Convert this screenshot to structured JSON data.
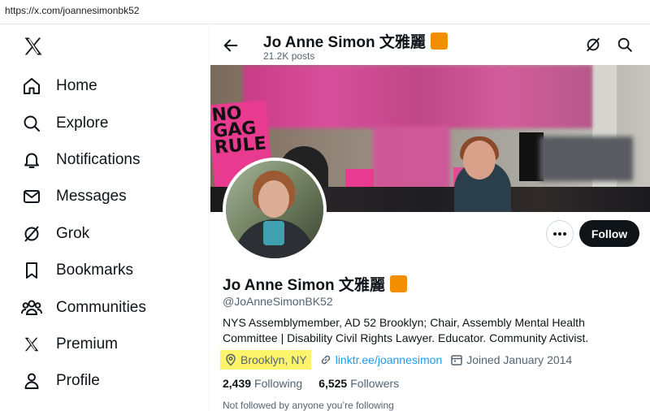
{
  "browser": {
    "url": "https://x.com/joannesimonbk52"
  },
  "sidebar": {
    "items": [
      {
        "label": "Home",
        "icon": "home-icon"
      },
      {
        "label": "Explore",
        "icon": "search-icon"
      },
      {
        "label": "Notifications",
        "icon": "bell-icon"
      },
      {
        "label": "Messages",
        "icon": "envelope-icon"
      },
      {
        "label": "Grok",
        "icon": "grok-icon"
      },
      {
        "label": "Bookmarks",
        "icon": "bookmark-icon"
      },
      {
        "label": "Communities",
        "icon": "people-icon"
      },
      {
        "label": "Premium",
        "icon": "x-logo-icon"
      },
      {
        "label": "Profile",
        "icon": "person-icon"
      }
    ]
  },
  "header": {
    "name": "Jo Anne Simon 文雅麗",
    "posts": "21.2K posts"
  },
  "banner": {
    "sign_text": "NO GAG RULE"
  },
  "profile": {
    "name": "Jo Anne Simon 文雅麗",
    "handle": "@JoAnneSimonBK52",
    "bio": "NYS Assemblymember, AD 52 Brooklyn; Chair, Assembly Mental Health Committee | Disability Civil Rights Lawyer. Educator. Community Activist.",
    "location": "Brooklyn, NY",
    "link": "linktr.ee/joannesimon",
    "joined": "Joined January 2014",
    "following_count": "2,439",
    "following_label": "Following",
    "followers_count": "6,525",
    "followers_label": "Followers",
    "not_followed": "Not followed by anyone you’re following",
    "follow_label": "Follow"
  },
  "colors": {
    "accent": "#1d9bf0",
    "badge": "#f18f01",
    "highlight": "#fef46c",
    "text": "#0f1419",
    "muted": "#536471"
  }
}
